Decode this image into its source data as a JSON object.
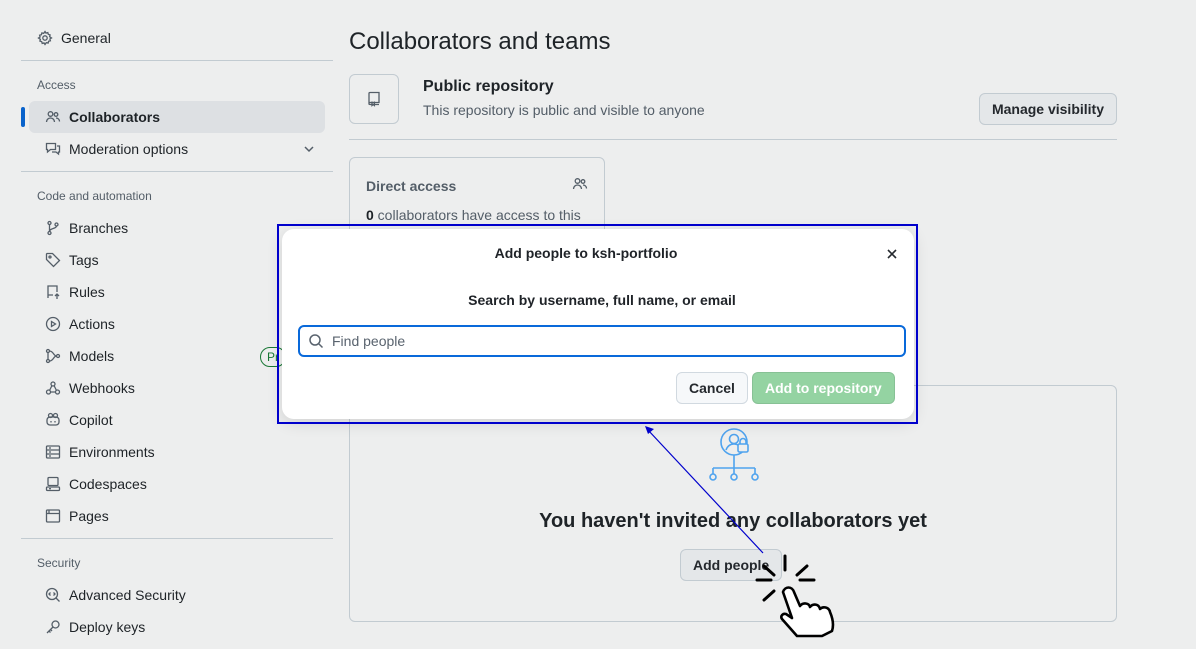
{
  "sidebar": {
    "general": "General",
    "access_heading": "Access",
    "collaborators": "Collaborators",
    "moderation": "Moderation options",
    "code_heading": "Code and automation",
    "branches": "Branches",
    "tags": "Tags",
    "rules": "Rules",
    "actions": "Actions",
    "models": "Models",
    "models_badge": "Pr",
    "webhooks": "Webhooks",
    "copilot": "Copilot",
    "environments": "Environments",
    "codespaces": "Codespaces",
    "pages": "Pages",
    "security_heading": "Security",
    "advanced_security": "Advanced Security",
    "deploy_keys": "Deploy keys"
  },
  "main": {
    "title": "Collaborators and teams",
    "visibility_title": "Public repository",
    "visibility_sub": "This repository is public and visible to anyone",
    "manage_visibility": "Manage visibility",
    "direct_access": "Direct access",
    "direct_count": "0",
    "direct_sub": " collaborators have access to this",
    "empty_text": "You haven't invited any collaborators yet",
    "add_people": "Add people"
  },
  "dialog": {
    "title": "Add people to ksh-portfolio",
    "label": "Search by username, full name, or email",
    "placeholder": "Find people",
    "cancel": "Cancel",
    "add": "Add to repository"
  },
  "colors": {
    "accent": "#0969da",
    "annotation": "#0000cc",
    "add_disabled": "#94d3a2"
  }
}
